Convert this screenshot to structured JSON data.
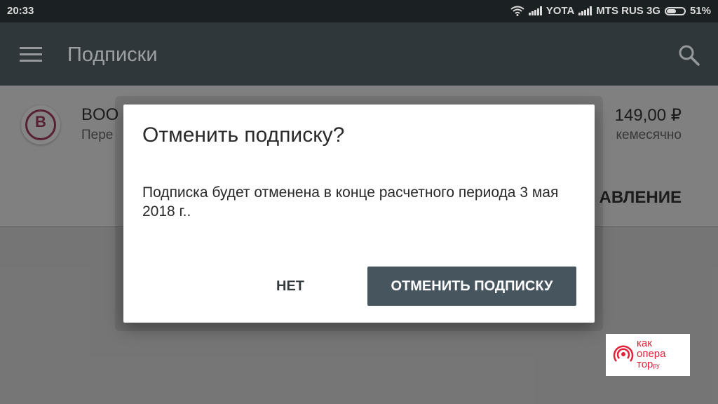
{
  "status_bar": {
    "time": "20:33",
    "carrier1": "YOTA",
    "carrier2": "MTS RUS 3G",
    "battery": "51%"
  },
  "app_bar": {
    "title": "Подписки",
    "menu_icon": "hamburger-menu-icon",
    "search_icon": "search-icon"
  },
  "subscription": {
    "name": "BOO",
    "period": "Пере",
    "price": "149,00 ₽",
    "frequency": "кемесячно",
    "manage_label": "АВЛЕНИЕ",
    "icon_letter": "B"
  },
  "dialog": {
    "title": "Отменить подписку?",
    "message": "Подписка будет отменена в конце расчетного периода 3 мая 2018 г..",
    "no_label": "НЕТ",
    "confirm_label": "ОТМЕНИТЬ ПОДПИСКУ"
  },
  "watermark": {
    "line1": "как",
    "line2": "опера",
    "line3": "тор",
    "suffix": "ру"
  },
  "colors": {
    "app_bar": "#333b3f",
    "status_bar": "#1d2225",
    "confirm_button": "#47555f",
    "brand_red": "#e2213a"
  }
}
